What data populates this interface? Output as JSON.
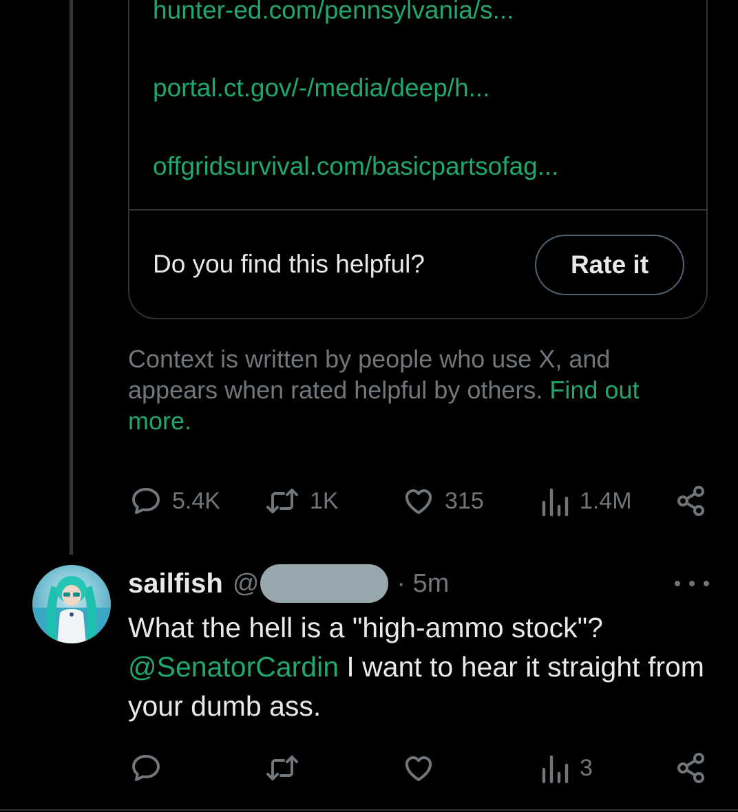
{
  "note": {
    "sources": [
      "hunter-ed.com/pennsylvania/s...",
      "portal.ct.gov/-/media/deep/h...",
      "offgridsurvival.com/basicpartsofag..."
    ],
    "helpful_question": "Do you find this helpful?",
    "rate_button": "Rate it",
    "context_text": "Context is written by people who use X, and appears when rated helpful by others. ",
    "find_out_more": "Find out more",
    "find_out_more_suffix": "."
  },
  "main_tweet_actions": {
    "replies": "5.4K",
    "reposts": "1K",
    "likes": "315",
    "views": "1.4M"
  },
  "reply_tweet": {
    "display_name": "sailfish",
    "handle_prefix": "@",
    "time": "· 5m",
    "text_before": "What the hell is a \"high-ammo stock\"? ",
    "mention": "@SenatorCardin",
    "text_after": " I want to hear it straight from your dumb ass.",
    "actions": {
      "replies": "",
      "reposts": "",
      "likes": "",
      "views": "3"
    }
  },
  "colors": {
    "background": "#000000",
    "text": "#e7e9ea",
    "muted": "#71767b",
    "link": "#1fa86d",
    "border": "#2f3336"
  },
  "icons": [
    "reply-icon",
    "repost-icon",
    "like-icon",
    "views-icon",
    "share-icon",
    "more-icon"
  ]
}
